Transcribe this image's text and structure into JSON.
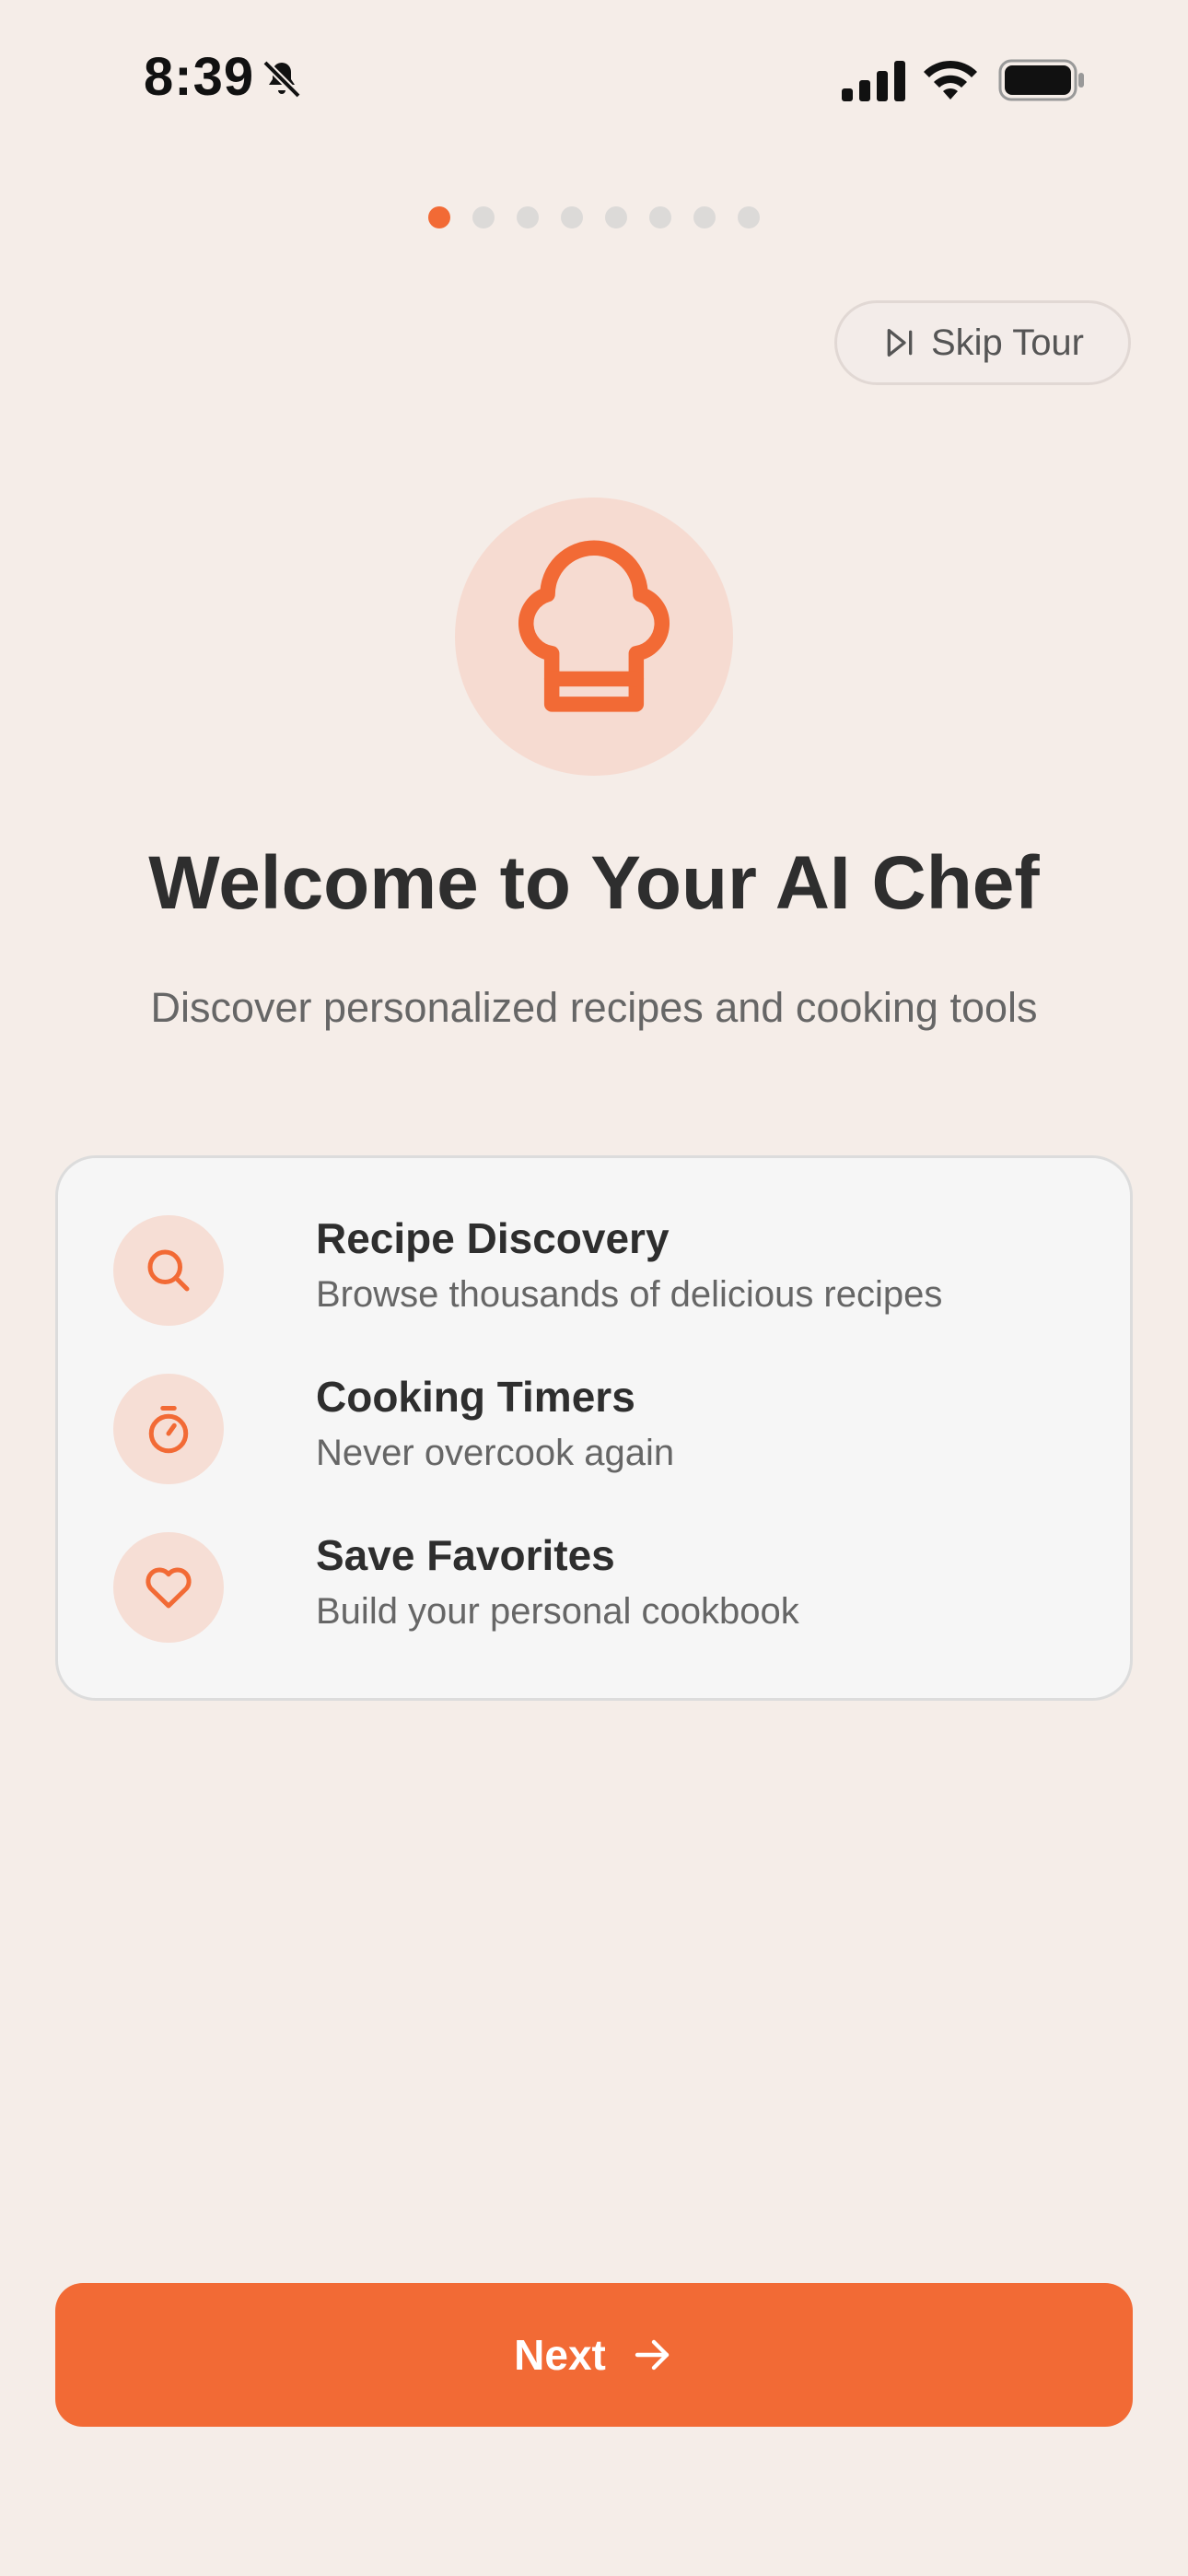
{
  "status_bar": {
    "time": "8:39"
  },
  "pagination": {
    "total": 8,
    "active_index": 0
  },
  "skip": {
    "label": "Skip Tour"
  },
  "hero": {
    "icon": "chef-hat-icon"
  },
  "title": "Welcome to Your AI Chef",
  "subtitle": "Discover personalized recipes and cooking tools",
  "features": [
    {
      "icon": "search-icon",
      "title": "Recipe Discovery",
      "description": "Browse thousands of delicious recipes"
    },
    {
      "icon": "timer-icon",
      "title": "Cooking Timers",
      "description": "Never overcook again"
    },
    {
      "icon": "heart-icon",
      "title": "Save Favorites",
      "description": "Build your personal cookbook"
    }
  ],
  "next": {
    "label": "Next",
    "icon": "arrow-right-icon"
  },
  "colors": {
    "accent": "#F26A35",
    "accent_light": "#F6DBD1",
    "background": "#F5EDE8",
    "card": "#F6F6F6"
  }
}
